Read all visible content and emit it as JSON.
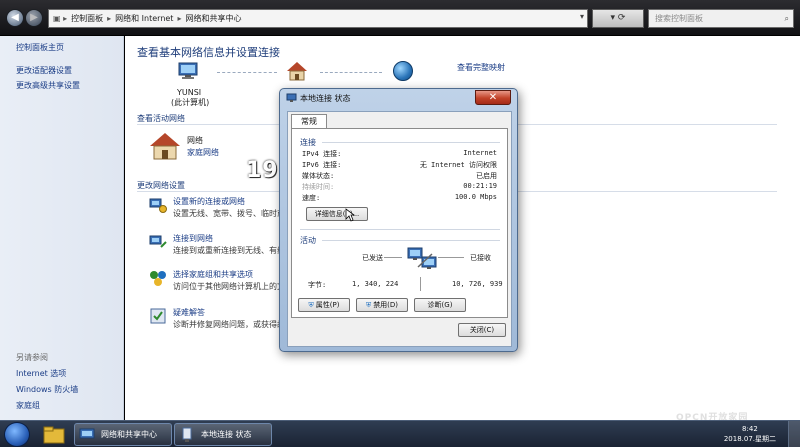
{
  "address_bar": {
    "crumbs": [
      "控制面板",
      "网络和 Internet",
      "网络和共享中心"
    ],
    "search_placeholder": "搜索控制面板"
  },
  "left_pane": {
    "links": [
      "控制面板主页",
      "更改适配器设置",
      "更改高级共享设置"
    ],
    "see_also_title": "另请参阅",
    "see_also": [
      "Internet 选项",
      "Windows 防火墙",
      "家庭组"
    ]
  },
  "main": {
    "heading": "查看基本网络信息并设置连接",
    "show_full_map": "查看完整映射",
    "computer_name": "YUNSI",
    "computer_sub": "(此计算机)",
    "active_networks_title": "查看活动网络",
    "network_name": "网络",
    "network_type": "家庭网络",
    "change_settings_title": "更改网络设置",
    "tasks": [
      {
        "title": "设置新的连接或网络",
        "desc": "设置无线、宽带、拨号、临时或 VPN 连接；或设置路由器或访问点。"
      },
      {
        "title": "连接到网络",
        "desc": "连接到或重新连接到无线、有线、拨号或 VPN 网络连接。"
      },
      {
        "title": "选择家庭组和共享选项",
        "desc": "访问位于其他网络计算机上的文件和打印机，或更改共享设置。"
      },
      {
        "title": "疑难解答",
        "desc": "诊断并修复网络问题，或获得故障排除信息。"
      }
    ]
  },
  "watermark": "191路由网",
  "dialog": {
    "title": "本地连接 状态",
    "tab": "常规",
    "connection_group": "连接",
    "rows": [
      {
        "k": "IPv4 连接:",
        "v": "Internet"
      },
      {
        "k": "IPv6 连接:",
        "v": "无 Internet 访问权限"
      },
      {
        "k": "媒体状态:",
        "v": "已启用"
      },
      {
        "k": "持续时间:",
        "v": "00:21:19"
      },
      {
        "k": "速度:",
        "v": "100.0 Mbps"
      }
    ],
    "details_button": "详细信息(E)...",
    "activity_group": "活动",
    "sent_label": "已发送",
    "received_label": "已接收",
    "bytes_label": "字节:",
    "bytes_sent": "1, 340, 224",
    "bytes_received": "10, 726, 939",
    "btn_properties": "属性(P)",
    "btn_disable": "禁用(D)",
    "btn_diagnose": "诊断(G)",
    "btn_close": "关闭(C)"
  },
  "taskbar": {
    "items": [
      "网络和共享中心",
      "本地连接 状态"
    ],
    "time": "8:42",
    "date": "2018.07.星期二"
  },
  "brand_watermark": "OPCN开放家园",
  "colors": {
    "link": "#1b3d86",
    "heading": "#1e3d7a",
    "close_red": "#c24128"
  }
}
